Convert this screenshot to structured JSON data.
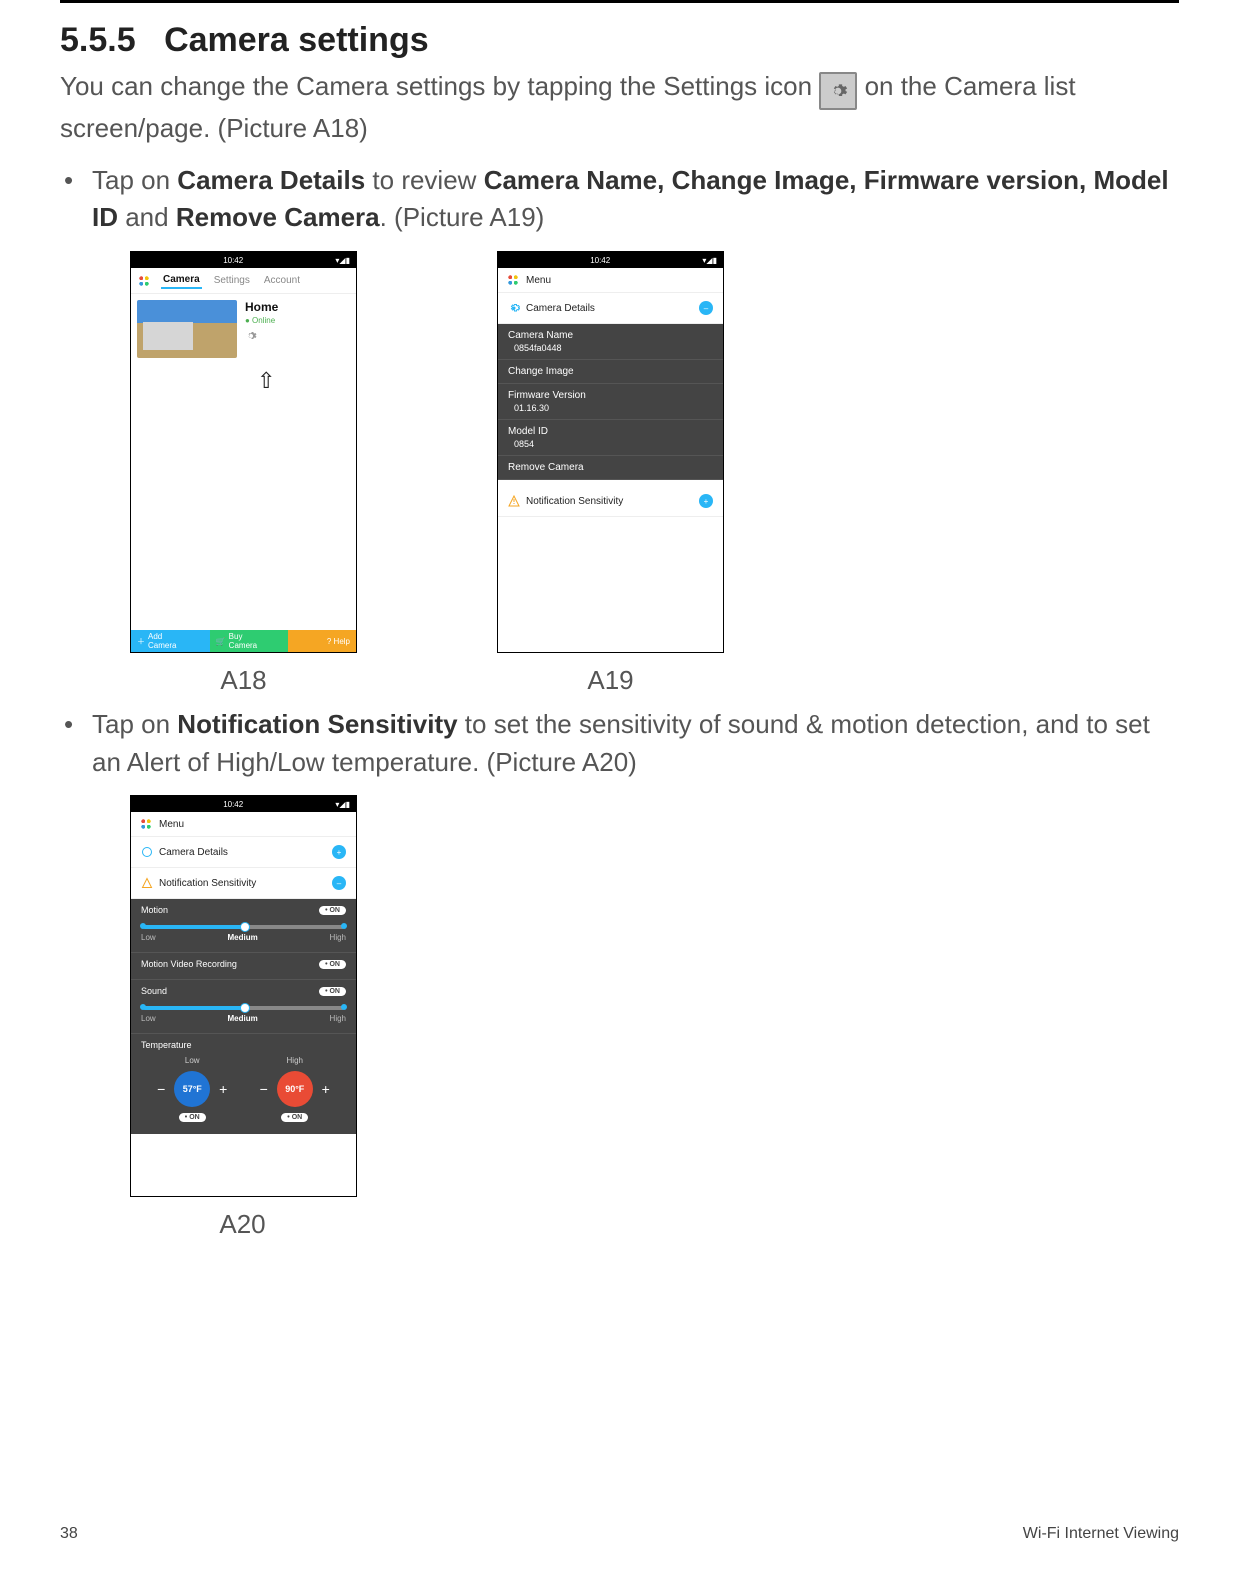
{
  "section": {
    "num": "5.5.5",
    "title": "Camera settings"
  },
  "intro": {
    "pre": "You can change the Camera settings by tapping the Settings icon ",
    "post": " on the Camera list screen/page. (Picture A18)"
  },
  "bullet1": {
    "lead": "Tap on ",
    "b1": "Camera Details",
    "mid1": " to review ",
    "b2": "Camera Name, Change Image, Firmware version, Model ID",
    "mid2": " and ",
    "b3": "Remove Camera",
    "tail": ". (Picture A19)"
  },
  "a18": {
    "time": "10:42",
    "tabs": {
      "camera": "Camera",
      "settings": "Settings",
      "account": "Account"
    },
    "card": {
      "name": "Home",
      "status": "● Online"
    },
    "bottom": {
      "add_l1": "Add",
      "add_l2": "Camera",
      "buy_l1": "Buy",
      "buy_l2": "Camera",
      "help": "?  Help"
    },
    "caption": "A18"
  },
  "a19": {
    "time": "10:42",
    "menu": "Menu",
    "rows": {
      "details": "Camera Details",
      "name_label": "Camera Name",
      "name_value": "0854fa0448",
      "change_image": "Change Image",
      "fw_label": "Firmware Version",
      "fw_value": "01.16.30",
      "model_label": "Model ID",
      "model_value": "0854",
      "remove": "Remove Camera",
      "notif": "Notification Sensitivity"
    },
    "caption": "A19"
  },
  "bullet2": {
    "lead": "Tap on ",
    "b1": "Notification Sensitivity",
    "tail": " to set the sensitivity of sound & motion detection, and to set an Alert of High/Low temperature. (Picture A20)"
  },
  "a20": {
    "time": "10:42",
    "menu": "Menu",
    "rows": {
      "details": "Camera Details",
      "notif": "Notification Sensitivity"
    },
    "motion": {
      "title": "Motion",
      "toggle": "• ON",
      "low": "Low",
      "medium": "Medium",
      "high": "High"
    },
    "mvr": {
      "title": "Motion Video Recording",
      "toggle": "• ON"
    },
    "sound": {
      "title": "Sound",
      "toggle": "• ON",
      "low": "Low",
      "medium": "Medium",
      "high": "High"
    },
    "temp": {
      "title": "Temperature",
      "low_label": "Low",
      "low_val": "57°F",
      "low_toggle": "• ON",
      "high_label": "High",
      "high_val": "90°F",
      "high_toggle": "• ON"
    },
    "caption": "A20"
  },
  "footer": {
    "page": "38",
    "chapter": "Wi-Fi Internet Viewing"
  }
}
